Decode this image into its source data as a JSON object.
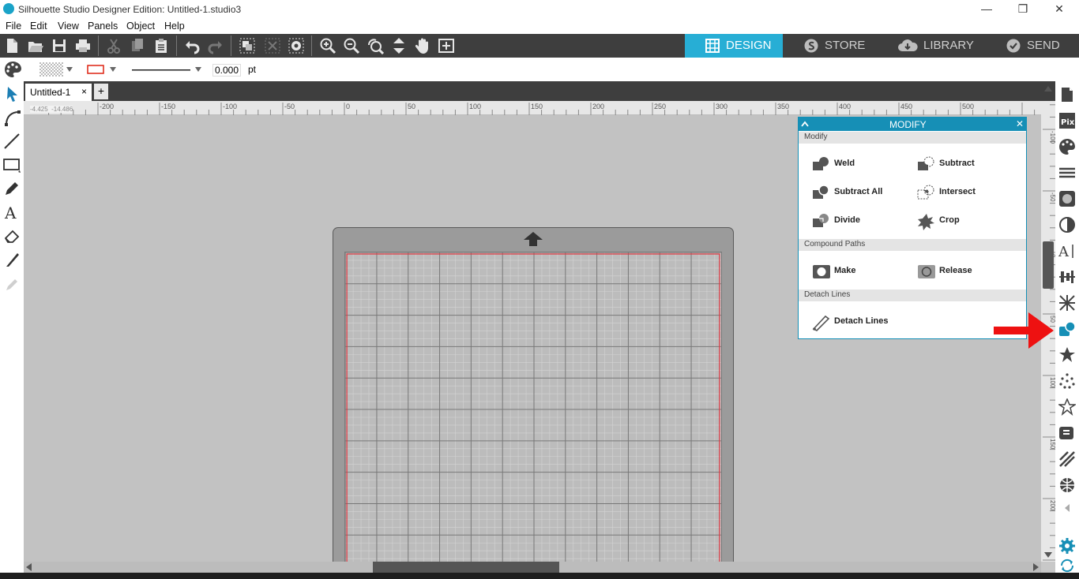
{
  "window": {
    "title": "Silhouette Studio Designer Edition: Untitled-1.studio3",
    "minimize": "—",
    "restore": "❒",
    "close": "✕"
  },
  "menu": [
    "File",
    "Edit",
    "View",
    "Panels",
    "Object",
    "Help"
  ],
  "nav_tabs": [
    {
      "label": "DESIGN",
      "active": true,
      "icon": "grid-icon"
    },
    {
      "label": "STORE",
      "active": false,
      "icon": "store-icon"
    },
    {
      "label": "LIBRARY",
      "active": false,
      "icon": "cloud-icon"
    },
    {
      "label": "SEND",
      "active": false,
      "icon": "check-circle-icon"
    }
  ],
  "property_bar": {
    "line_width": "0.000",
    "unit": "pt"
  },
  "doc_tab": {
    "name": "Untitled-1",
    "close": "×",
    "add": "+"
  },
  "coords": {
    "x": "-4.425",
    "y": "-14.486"
  },
  "hruler": {
    "ticks": [
      "-200",
      "-150",
      "-100",
      "-50",
      "0",
      "50",
      "100",
      "150",
      "200",
      "250",
      "300",
      "350",
      "400",
      "450",
      "500"
    ]
  },
  "vruler": {
    "ticks": [
      "-100",
      "-50",
      "0",
      "50",
      "100",
      "150",
      "200"
    ]
  },
  "modify_panel": {
    "title": "MODIFY",
    "close": "✕",
    "sections": [
      {
        "label": "Modify",
        "buttons": [
          "Weld",
          "Subtract",
          "Subtract All",
          "Intersect",
          "Divide",
          "Crop"
        ]
      },
      {
        "label": "Compound Paths",
        "buttons": [
          "Make",
          "Release"
        ]
      },
      {
        "label": "Detach Lines",
        "buttons": [
          "Detach Lines"
        ]
      }
    ]
  },
  "colors": {
    "accent": "#27aed5",
    "panel_header": "#168fb6",
    "toolbar": "#3e3e3e",
    "annotation_arrow": "#ee1111",
    "cut_line": "#e0353f"
  }
}
